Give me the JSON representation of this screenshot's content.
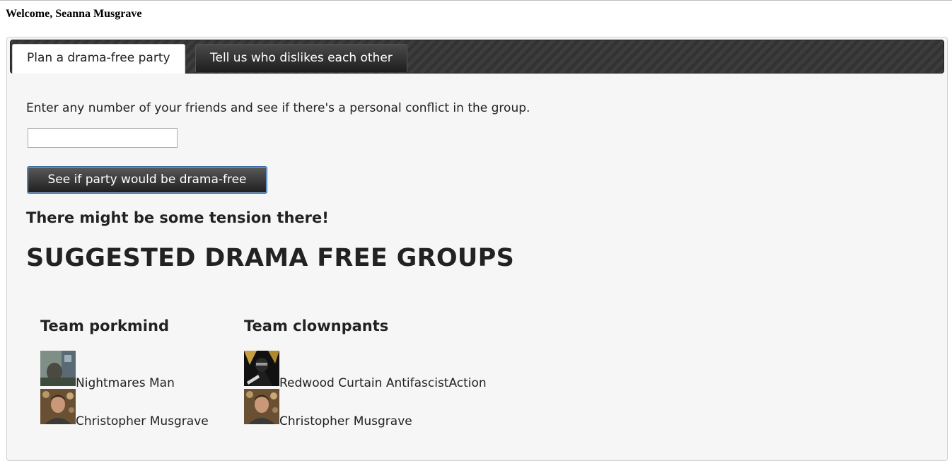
{
  "header": {
    "welcome": "Welcome, Seanna Musgrave"
  },
  "tabs": [
    {
      "label": "Plan a drama-free party",
      "active": true
    },
    {
      "label": "Tell us who dislikes each other",
      "active": false
    }
  ],
  "planner": {
    "intro": "Enter any number of your friends and see if there's a personal conflict in the group.",
    "friends_input": {
      "value": "",
      "placeholder": ""
    },
    "check_button": "See if party would be drama-free",
    "result_message": "There might be some tension there!",
    "groups_heading": "SUGGESTED DRAMA FREE GROUPS",
    "teams": [
      {
        "name": "Team porkmind",
        "members": [
          {
            "name": "Nightmares Man",
            "avatar": "nightmares-man-avatar"
          },
          {
            "name": "Christopher Musgrave",
            "avatar": "christopher-musgrave-avatar"
          }
        ]
      },
      {
        "name": "Team clownpants",
        "members": [
          {
            "name": "Redwood Curtain AntifascistAction",
            "avatar": "redwood-curtain-avatar"
          },
          {
            "name": "Christopher Musgrave",
            "avatar": "christopher-musgrave-avatar"
          }
        ]
      }
    ]
  },
  "colors": {
    "tabbar_bg": "#333333",
    "page_bg": "#f6f6f6",
    "button_border": "#3a6ea8",
    "text": "#222222"
  }
}
